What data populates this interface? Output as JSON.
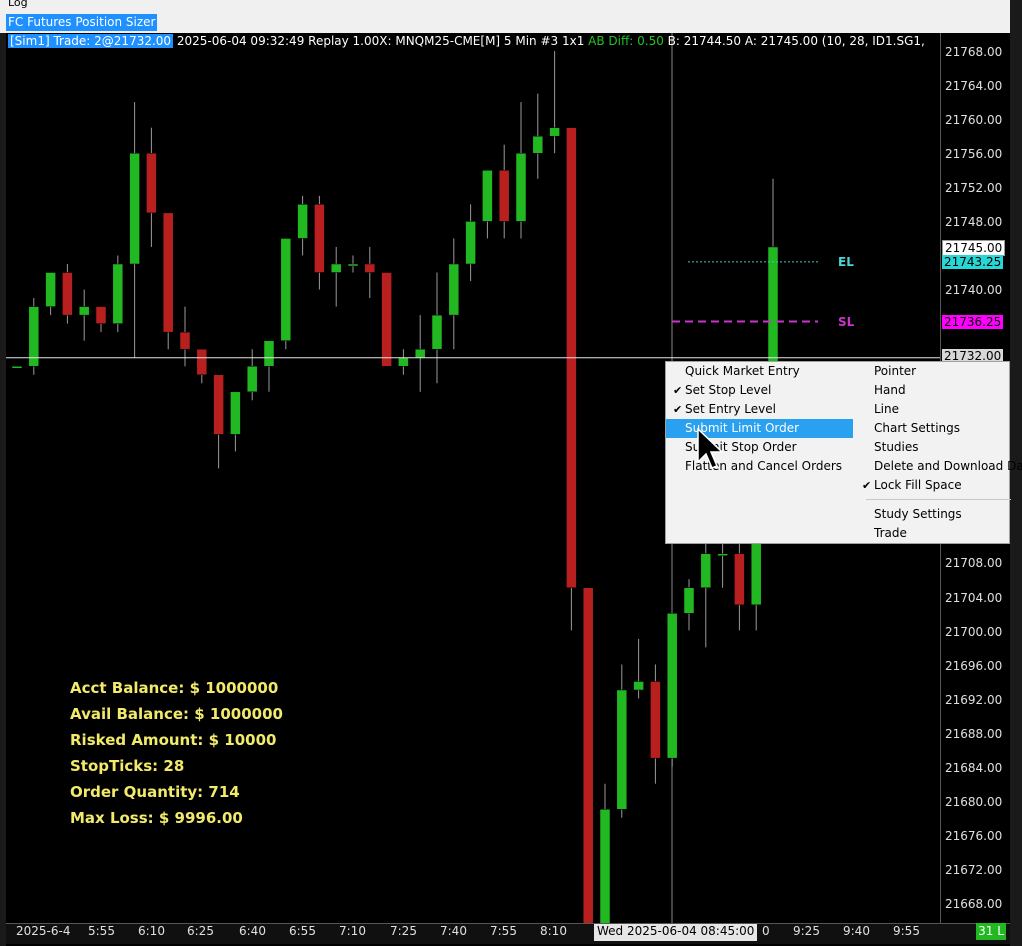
{
  "window": {
    "top_label": "Log",
    "study_tag": "FC Futures Position Sizer"
  },
  "info_line": {
    "sim_trade": "[Sim1]  Trade: 2@21732.00",
    "main": " 2025-06-04 09:32:49 Replay 1.00X: MNQM25-CME[M]  5 Min  #3 1x1 ",
    "ab_diff": "AB Diff: 0.50",
    "bid_ask": " B: 21744.50 A: 21745.00  (10, 28, ID1.SG1,"
  },
  "price_axis": {
    "labels": [
      "21768.00",
      "21764.00",
      "21760.00",
      "21756.00",
      "21752.00",
      "21748.00",
      "21745.00",
      "21740.00",
      "21736.00",
      "21732.00",
      "21708.00",
      "21704.00",
      "21700.00",
      "21696.00",
      "21692.00",
      "21688.00",
      "21684.00",
      "21680.00",
      "21676.00",
      "21672.00",
      "21668.00"
    ],
    "flag_white": "21745.00",
    "flag_cyan": "21743.25",
    "flag_magenta": "21736.25",
    "flag_gray": "21732.00"
  },
  "time_axis": {
    "start_label": "2025-6-4",
    "labels": [
      "5:55",
      "6:10",
      "6:25",
      "6:40",
      "6:55",
      "7:10",
      "7:25",
      "7:40",
      "7:55",
      "8:10",
      "9:25",
      "9:40",
      "9:55"
    ],
    "highlight": "Wed 2025-06-04  08:45:00",
    "after_highlight": "0",
    "corner_badge": "31 L"
  },
  "levels": {
    "entry_label": "EL",
    "stop_label": "SL"
  },
  "stats": {
    "acct_balance": "Acct Balance: $ 1000000",
    "avail_balance": "Avail Balance: $ 1000000",
    "risked_amount": "Risked Amount: $ 10000",
    "stop_ticks": "StopTicks: 28",
    "order_quantity": "Order Quantity:  714",
    "max_loss": "Max Loss: $ 9996.00"
  },
  "context_menu": {
    "left": [
      {
        "label": "Quick Market Entry",
        "checked": false,
        "highlighted": false
      },
      {
        "label": "Set Stop Level",
        "checked": true,
        "highlighted": false
      },
      {
        "label": "Set Entry Level",
        "checked": true,
        "highlighted": false
      },
      {
        "label": "Submit Limit Order",
        "checked": false,
        "highlighted": true
      },
      {
        "label": "Submit Stop Order",
        "checked": false,
        "highlighted": false
      },
      {
        "label": "Flatten and Cancel Orders",
        "checked": false,
        "highlighted": false
      }
    ],
    "right": [
      {
        "label": "Pointer",
        "checked": false
      },
      {
        "label": "Hand",
        "checked": false
      },
      {
        "label": "Line",
        "checked": false
      },
      {
        "label": "Chart Settings",
        "checked": false
      },
      {
        "label": "Studies",
        "checked": false
      },
      {
        "label": "Delete and Download Da",
        "checked": false
      },
      {
        "label": "Lock Fill Space",
        "checked": true
      },
      {
        "label": "Study Settings",
        "checked": false
      },
      {
        "label": "Trade",
        "checked": false
      }
    ]
  },
  "colors": {
    "up": "#22b822",
    "down": "#b82020",
    "menu_highlight": "#2aa0f0",
    "stats_text": "#f2ea6a"
  },
  "chart_data": {
    "type": "candlestick",
    "x": [
      "5:40",
      "5:45",
      "5:50",
      "5:55",
      "6:00",
      "6:05",
      "6:10",
      "6:15",
      "6:20",
      "6:25",
      "6:30",
      "6:35",
      "6:40",
      "6:45",
      "6:50",
      "6:55",
      "7:00",
      "7:05",
      "7:10",
      "7:15",
      "7:20",
      "7:25",
      "7:30",
      "7:35",
      "7:40",
      "7:45",
      "7:50",
      "7:55",
      "8:00",
      "8:05",
      "8:10",
      "8:15",
      "8:20",
      "8:25",
      "8:30",
      "8:35",
      "8:40",
      "8:45",
      "8:50",
      "8:55",
      "9:00",
      "9:05",
      "9:10",
      "9:15",
      "9:20",
      "9:25"
    ],
    "series": [
      {
        "values": [
          [
            21731,
            21731,
            21731,
            21731
          ],
          [
            21731,
            21739,
            21730,
            21738
          ],
          [
            21738,
            21742,
            21737,
            21742
          ],
          [
            21742,
            21743,
            21736,
            21737
          ],
          [
            21737,
            21740,
            21734,
            21738
          ],
          [
            21738,
            21738,
            21735,
            21736
          ],
          [
            21736,
            21744,
            21735,
            21743
          ],
          [
            21743,
            21762,
            21732,
            21756
          ],
          [
            21756,
            21759,
            21745,
            21749
          ],
          [
            21749,
            21749,
            21733,
            21735
          ],
          [
            21735,
            21738,
            21731,
            21733
          ],
          [
            21733,
            21733,
            21729,
            21730
          ],
          [
            21730,
            21730,
            21719,
            21723
          ],
          [
            21723,
            21728,
            21721,
            21728
          ],
          [
            21728,
            21733,
            21727,
            21731
          ],
          [
            21731,
            21734,
            21728,
            21734
          ],
          [
            21734,
            21746,
            21733,
            21746
          ],
          [
            21746,
            21751,
            21744,
            21750
          ],
          [
            21750,
            21751,
            21740,
            21742
          ],
          [
            21742,
            21745,
            21738,
            21743
          ],
          [
            21743,
            21744,
            21742,
            21743
          ],
          [
            21743,
            21745,
            21739,
            21742
          ],
          [
            21742,
            21742,
            21731,
            21731
          ],
          [
            21731,
            21733,
            21730,
            21732
          ],
          [
            21732,
            21737,
            21728,
            21733
          ],
          [
            21733,
            21742,
            21729,
            21737
          ],
          [
            21737,
            21746,
            21733,
            21743
          ],
          [
            21743,
            21750,
            21741,
            21748
          ],
          [
            21748,
            21754,
            21746,
            21754
          ],
          [
            21754,
            21757,
            21746,
            21748
          ],
          [
            21748,
            21762,
            21746,
            21756
          ],
          [
            21756,
            21763,
            21753,
            21758
          ],
          [
            21758,
            21768,
            21756,
            21759
          ],
          [
            21759,
            21759,
            21700,
            21705
          ],
          [
            21705,
            21705,
            21664,
            21664
          ],
          [
            21664,
            21682,
            21664,
            21679
          ],
          [
            21679,
            21696,
            21678,
            21693
          ],
          [
            21693,
            21699,
            21692,
            21694
          ],
          [
            21694,
            21696,
            21682,
            21685
          ],
          [
            21685,
            21702,
            21684,
            21702
          ],
          [
            21702,
            21706,
            21700,
            21705
          ],
          [
            21705,
            21712,
            21698,
            21709
          ],
          [
            21709,
            21712,
            21705,
            21709
          ],
          [
            21709,
            21711,
            21700,
            21703
          ],
          [
            21703,
            21716,
            21700,
            21711
          ],
          [
            21711,
            21753,
            21711,
            21745
          ]
        ]
      }
    ],
    "ylim": [
      21664,
      21770
    ],
    "entry_level": 21743.25,
    "stop_level": 21736.25,
    "trade_price": 21732.0
  }
}
